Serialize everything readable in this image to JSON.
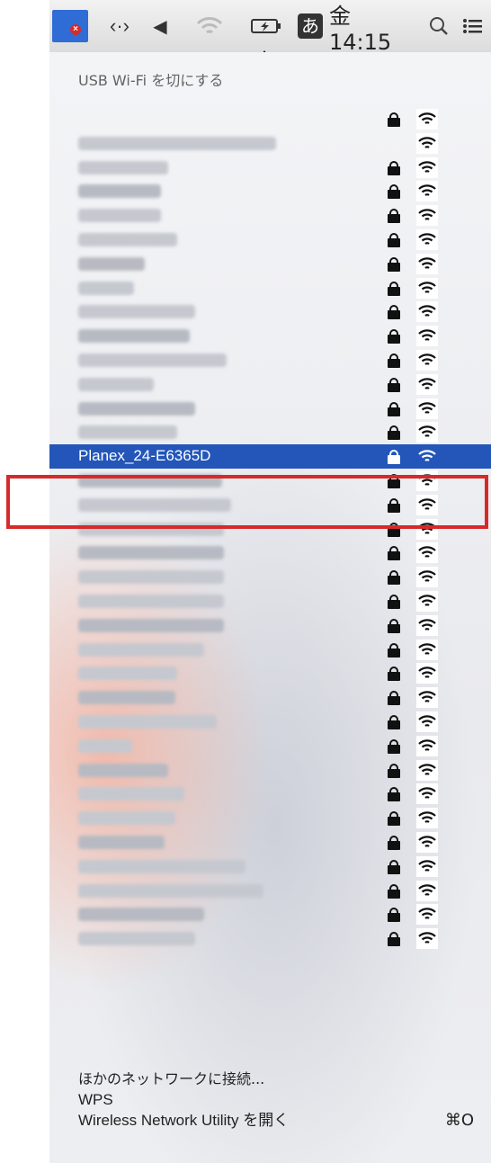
{
  "menubar": {
    "clock": "金 14:15",
    "ime": "あ",
    "code_icon": "‹·›",
    "volume_icon": "◀",
    "battery_icon": "⚡",
    "search_icon": "⚲",
    "list_icon": "☰"
  },
  "menu": {
    "header": "USB Wi-Fi を切にする",
    "selected_network": "Planex_24-E6365D",
    "networks": [
      {
        "locked": true,
        "bar": 0
      },
      {
        "locked": false,
        "bar": 220
      },
      {
        "locked": true,
        "bar": 100
      },
      {
        "locked": true,
        "bar": 92
      },
      {
        "locked": true,
        "bar": 92
      },
      {
        "locked": true,
        "bar": 110
      },
      {
        "locked": true,
        "bar": 74
      },
      {
        "locked": true,
        "bar": 62
      },
      {
        "locked": true,
        "bar": 130
      },
      {
        "locked": true,
        "bar": 124
      },
      {
        "locked": true,
        "bar": 165
      },
      {
        "locked": true,
        "bar": 84
      },
      {
        "locked": true,
        "bar": 130
      },
      {
        "locked": true,
        "bar": 110
      },
      {
        "locked": true,
        "bar": 0,
        "selected": true
      },
      {
        "locked": true,
        "bar": 160
      },
      {
        "locked": true,
        "bar": 170
      },
      {
        "locked": true,
        "bar": 162
      },
      {
        "locked": true,
        "bar": 162
      },
      {
        "locked": true,
        "bar": 162
      },
      {
        "locked": true,
        "bar": 162
      },
      {
        "locked": true,
        "bar": 162
      },
      {
        "locked": true,
        "bar": 140
      },
      {
        "locked": true,
        "bar": 110
      },
      {
        "locked": true,
        "bar": 108
      },
      {
        "locked": true,
        "bar": 154
      },
      {
        "locked": true,
        "bar": 60
      },
      {
        "locked": true,
        "bar": 100
      },
      {
        "locked": true,
        "bar": 118
      },
      {
        "locked": true,
        "bar": 108
      },
      {
        "locked": true,
        "bar": 96
      },
      {
        "locked": true,
        "bar": 186
      },
      {
        "locked": true,
        "bar": 206
      },
      {
        "locked": true,
        "bar": 140
      },
      {
        "locked": true,
        "bar": 130
      }
    ]
  },
  "bottom_items": {
    "other_network": "ほかのネットワークに接続...",
    "wps": "WPS",
    "utility": "Wireless Network Utility を開く",
    "utility_shortcut": "⌘O"
  }
}
